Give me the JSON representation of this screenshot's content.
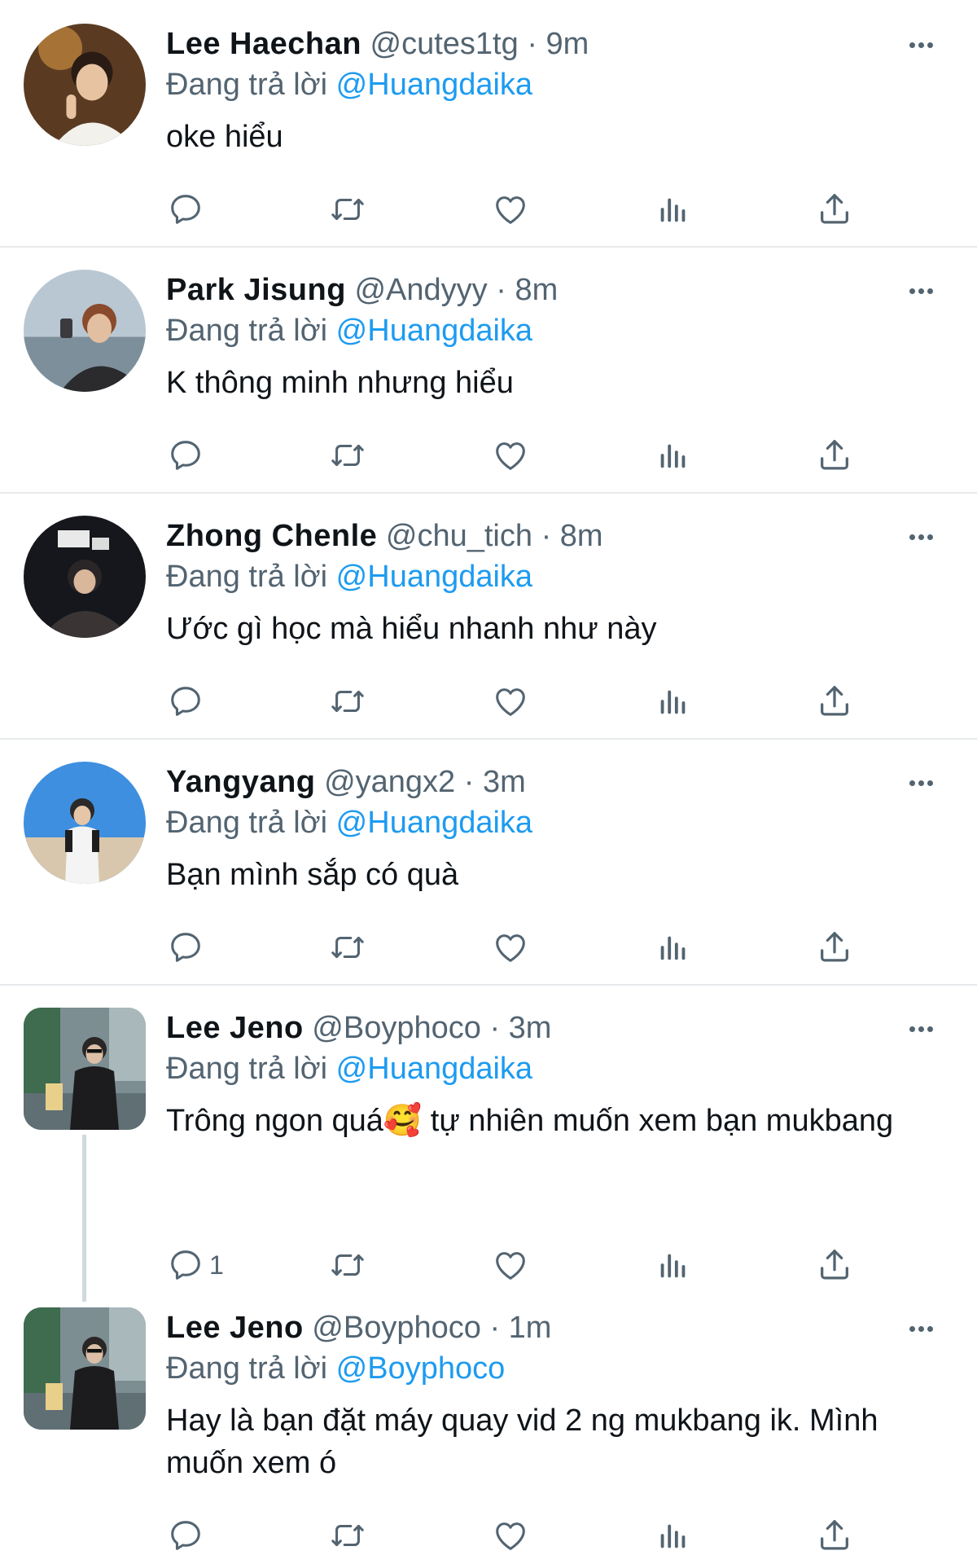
{
  "reply_prefix": "Đang trả lời",
  "colors": {
    "accent": "#1d9bf0",
    "secondary_text": "#536471",
    "divider": "#e6e9eb"
  },
  "icons": {
    "reply": "reply-icon",
    "retweet": "retweet-icon",
    "like": "like-icon",
    "views": "views-icon",
    "share": "share-icon",
    "more": "more-icon"
  },
  "tweets": [
    {
      "name": "Lee Haechan",
      "handle": "@cutes1tg",
      "time": "· 9m",
      "replying_to": "@Huangdaika",
      "text": "oke hiểu",
      "reply_count": ""
    },
    {
      "name": "Park Jisung",
      "handle": "@Andyyy",
      "time": "· 8m",
      "replying_to": "@Huangdaika",
      "text": "K thông minh nhưng hiểu",
      "reply_count": ""
    },
    {
      "name": "Zhong Chenle",
      "handle": "@chu_tich",
      "time": "· 8m",
      "replying_to": "@Huangdaika",
      "text": "Ước gì học mà hiểu nhanh như này",
      "reply_count": ""
    },
    {
      "name": "Yangyang",
      "handle": "@yangx2",
      "time": "· 3m",
      "replying_to": "@Huangdaika",
      "text": "Bạn mình sắp có quà",
      "reply_count": ""
    },
    {
      "name": "Lee Jeno",
      "handle": "@Boyphoco",
      "time": "· 3m",
      "replying_to": "@Huangdaika",
      "text": "Trông ngon quá🥰 tự nhiên muốn xem bạn mukbang",
      "reply_count": "1"
    },
    {
      "name": "Lee Jeno",
      "handle": "@Boyphoco",
      "time": "· 1m",
      "replying_to": "@Boyphoco",
      "text": "Hay là bạn đặt máy quay vid 2 ng mukbang ik. Mình muốn xem ó",
      "reply_count": ""
    }
  ]
}
